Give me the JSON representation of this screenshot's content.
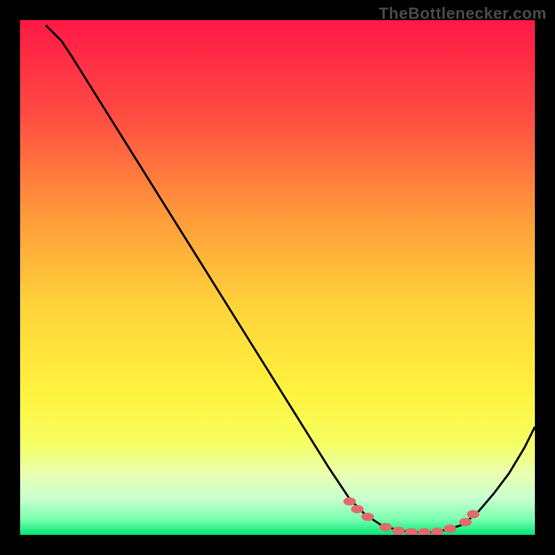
{
  "watermark": "TheBottlenecker.com",
  "colors": {
    "top": "#ff1846",
    "mid1": "#ff7a3c",
    "mid2": "#ffe23c",
    "mid3": "#f6ff60",
    "mid4": "#d8ffb0",
    "bottom": "#00e676",
    "line": "#000000",
    "marker": "#e06b6b",
    "bg": "#000000"
  },
  "chart_data": {
    "type": "line",
    "title": "",
    "xlabel": "",
    "ylabel": "",
    "xlim": [
      0,
      100
    ],
    "ylim": [
      0,
      100
    ],
    "curve": [
      {
        "x": 5,
        "y": 99
      },
      {
        "x": 8,
        "y": 96
      },
      {
        "x": 10,
        "y": 93
      },
      {
        "x": 15,
        "y": 85
      },
      {
        "x": 20,
        "y": 77
      },
      {
        "x": 25,
        "y": 69
      },
      {
        "x": 30,
        "y": 61
      },
      {
        "x": 35,
        "y": 53
      },
      {
        "x": 40,
        "y": 45
      },
      {
        "x": 45,
        "y": 37
      },
      {
        "x": 50,
        "y": 29
      },
      {
        "x": 55,
        "y": 21
      },
      {
        "x": 60,
        "y": 13
      },
      {
        "x": 64,
        "y": 7
      },
      {
        "x": 67,
        "y": 4
      },
      {
        "x": 70,
        "y": 2
      },
      {
        "x": 73,
        "y": 1
      },
      {
        "x": 76,
        "y": 0.5
      },
      {
        "x": 80,
        "y": 0.5
      },
      {
        "x": 83,
        "y": 1
      },
      {
        "x": 86,
        "y": 2
      },
      {
        "x": 89,
        "y": 4.5
      },
      {
        "x": 92,
        "y": 8
      },
      {
        "x": 95,
        "y": 12
      },
      {
        "x": 98,
        "y": 17
      },
      {
        "x": 100,
        "y": 21
      }
    ],
    "markers": [
      {
        "x": 64,
        "y": 6.5
      },
      {
        "x": 65.5,
        "y": 5
      },
      {
        "x": 67.5,
        "y": 3.5
      },
      {
        "x": 71,
        "y": 1.5
      },
      {
        "x": 73.5,
        "y": 0.8
      },
      {
        "x": 76,
        "y": 0.5
      },
      {
        "x": 78.5,
        "y": 0.5
      },
      {
        "x": 81,
        "y": 0.6
      },
      {
        "x": 83.5,
        "y": 1.2
      },
      {
        "x": 86.5,
        "y": 2.5
      },
      {
        "x": 88,
        "y": 4
      }
    ]
  }
}
